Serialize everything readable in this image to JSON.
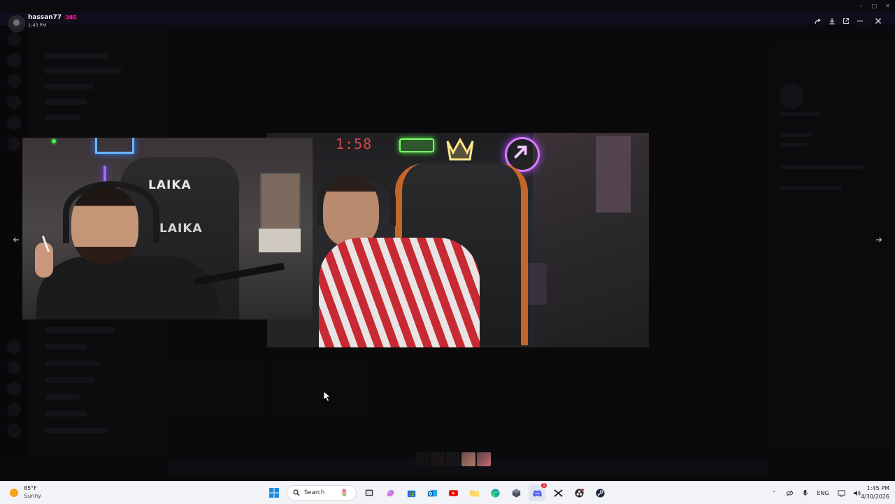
{
  "viewer": {
    "username": "hassan77",
    "badge": "385",
    "timestamp": "1:43 PM"
  },
  "overlay": {
    "timer_text": "1:58",
    "neon_brand": "LAIKA",
    "neon_brand_2": "LAIKA"
  },
  "taskbar": {
    "weather_temp": "85°F",
    "weather_condition": "Sunny",
    "search_label": "Search",
    "language": "ENG",
    "time": "1:45 PM",
    "date": "4/30/2026",
    "discord_badge": "1"
  },
  "icons": {
    "forward": "share-arrow-icon",
    "download": "download-icon",
    "open_external": "open-in-browser-icon",
    "more": "more-options-icon",
    "close": "close-icon",
    "prev": "arrow-left-icon",
    "next": "arrow-right-icon"
  },
  "colors": {
    "background": "#000000",
    "timer_red": "#d64848",
    "neon_green": "#7dff6e",
    "neon_purple": "#d87bff",
    "taskbar": "#f1f3f7"
  }
}
